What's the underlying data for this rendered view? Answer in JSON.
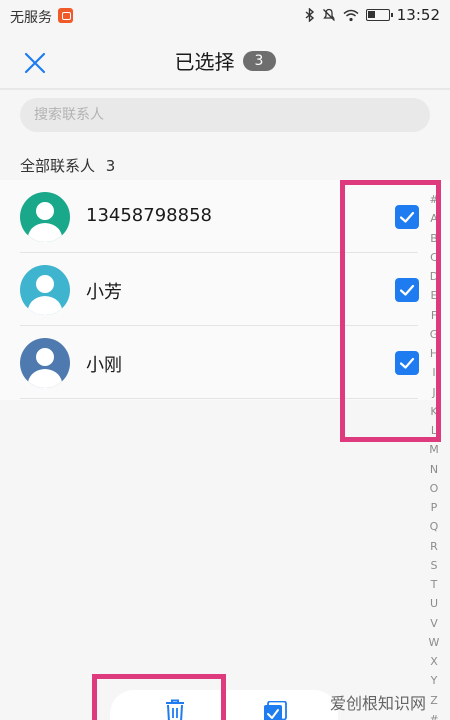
{
  "status_bar": {
    "carrier": "无服务",
    "time": "13:52"
  },
  "header": {
    "title": "已选择",
    "selected_count": "3"
  },
  "search": {
    "placeholder": "搜索联系人"
  },
  "section": {
    "label": "全部联系人",
    "count": "3"
  },
  "contacts": [
    {
      "name": "13458798858",
      "avatar_color": "#1aa88a",
      "checked": true
    },
    {
      "name": "小芳",
      "avatar_color": "#3fb4cf",
      "checked": true
    },
    {
      "name": "小刚",
      "avatar_color": "#4f7ab0",
      "checked": true
    }
  ],
  "alpha_index": [
    "#",
    "A",
    "B",
    "C",
    "D",
    "E",
    "F",
    "G",
    "H",
    "I",
    "J",
    "K",
    "L",
    "M",
    "N",
    "O",
    "P",
    "Q",
    "R",
    "S",
    "T",
    "U",
    "V",
    "W",
    "X",
    "Y",
    "Z",
    "#"
  ],
  "watermark": "爱创根知识网",
  "colors": {
    "accent": "#1e7cf0",
    "highlight": "#dd3b7d"
  }
}
